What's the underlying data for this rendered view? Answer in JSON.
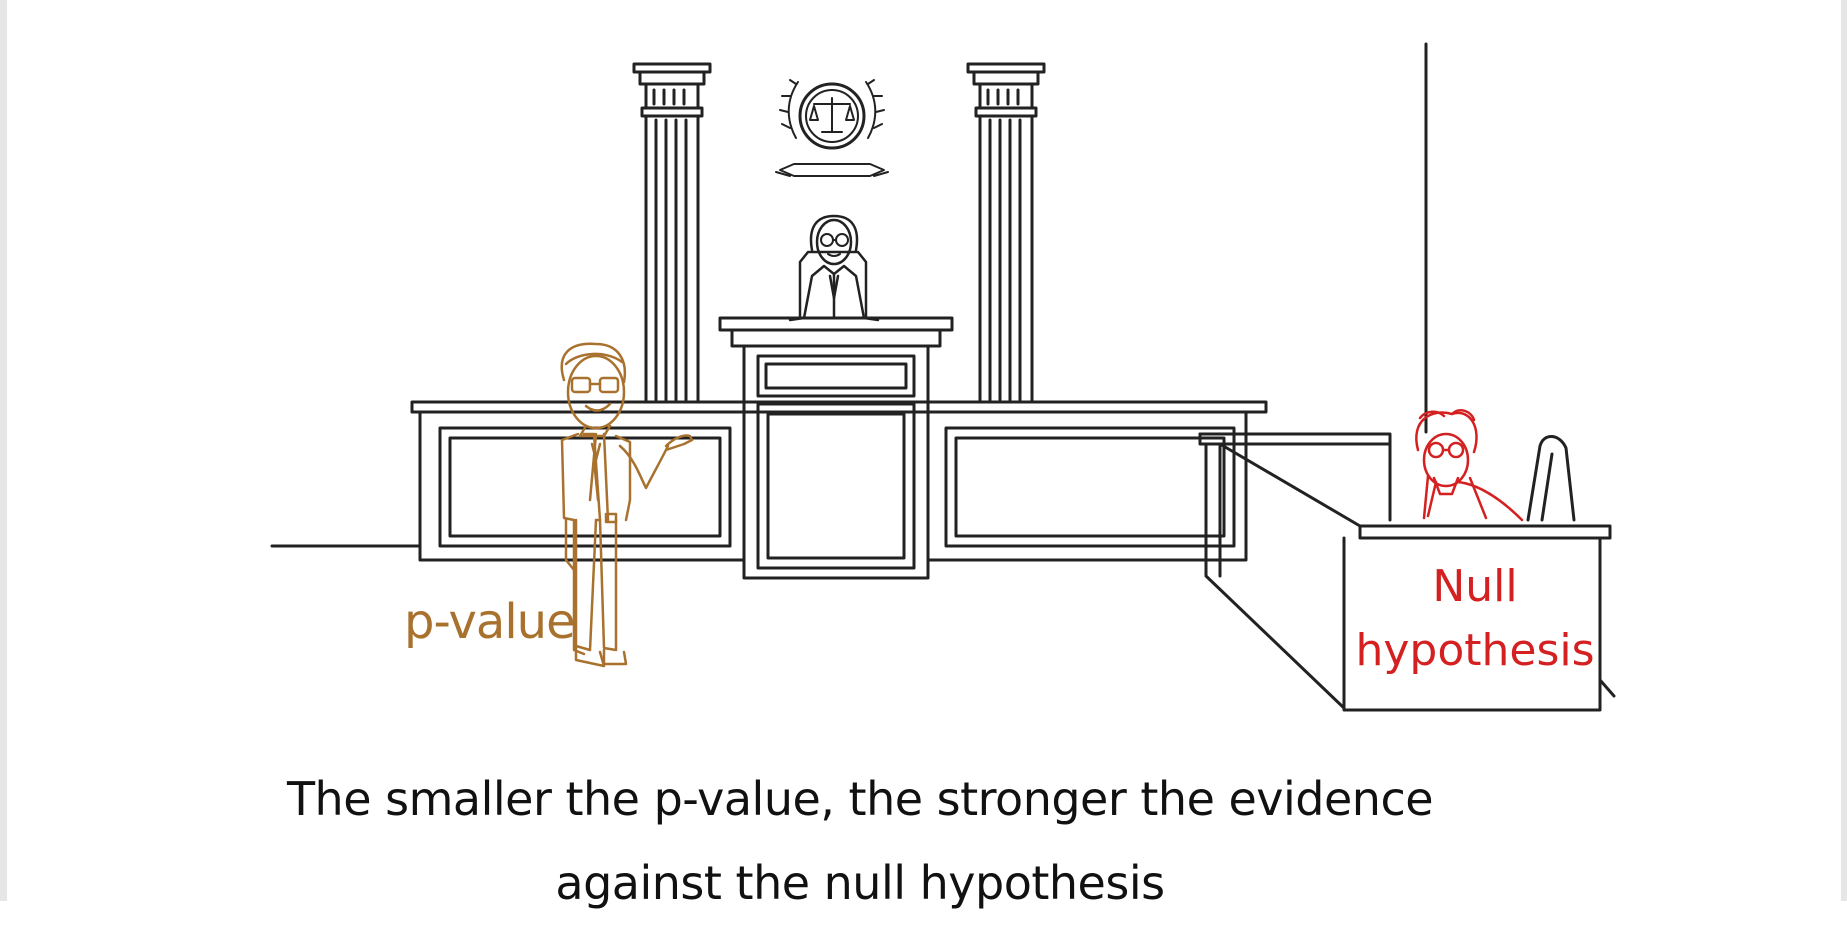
{
  "labels": {
    "p_value": "p-value",
    "null_hypothesis": "Null hypothesis"
  },
  "caption": "The smaller the p-value, the stronger the evidence against the null hypothesis",
  "colors": {
    "p_value": "#a8722e",
    "null_hypothesis": "#d42020",
    "line_art": "#222222",
    "caption": "#111111"
  },
  "figures": [
    "scales-of-justice-emblem",
    "judge",
    "lawyer",
    "defendant"
  ]
}
